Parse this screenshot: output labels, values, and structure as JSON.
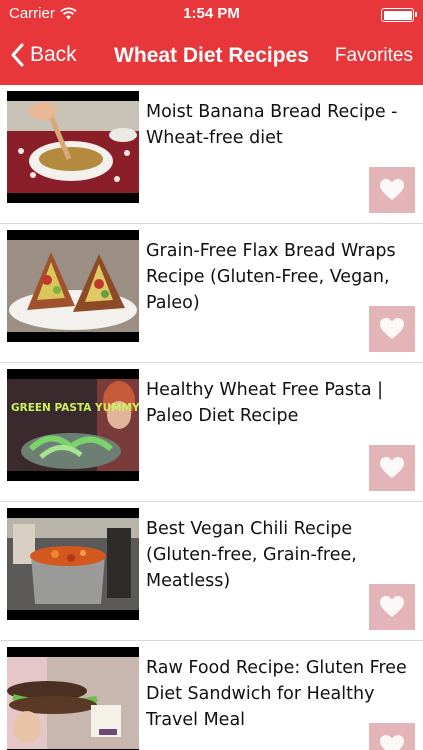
{
  "status_bar": {
    "carrier": "Carrier",
    "time": "1:54 PM"
  },
  "nav": {
    "back_label": "Back",
    "title": "Wheat Diet Recipes",
    "favorites_label": "Favorites"
  },
  "colors": {
    "accent": "#e8373a",
    "heart_button": "#e4b5b8"
  },
  "recipes": [
    {
      "title": "Moist Banana Bread Recipe - Wheat-free diet",
      "icon": "heart-icon"
    },
    {
      "title": "Grain-Free Flax Bread Wraps Recipe (Gluten-Free, Vegan, Paleo)",
      "icon": "heart-icon"
    },
    {
      "title": "Healthy Wheat Free Pasta | Paleo Diet Recipe",
      "icon": "heart-icon",
      "thumb_text": "GREEN PASTA YUMMY!"
    },
    {
      "title": "Best Vegan Chili Recipe (Gluten-free, Grain-free, Meatless)",
      "icon": "heart-icon"
    },
    {
      "title": "Raw Food Recipe:  Gluten Free Diet Sandwich for Healthy Travel Meal",
      "icon": "heart-icon"
    }
  ]
}
